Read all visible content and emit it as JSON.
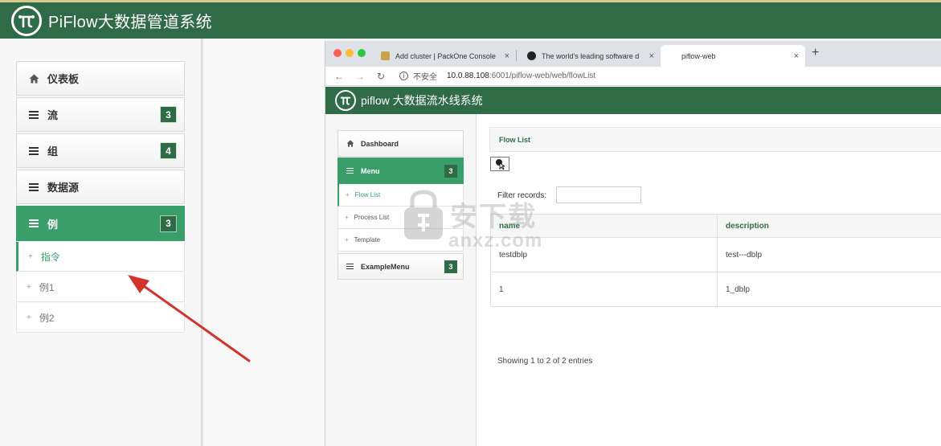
{
  "app": {
    "title": "PiFlow大数据管道系统"
  },
  "sidebar": {
    "items": [
      {
        "label": "仪表板",
        "icon": "home-icon",
        "badge": ""
      },
      {
        "label": "流",
        "icon": "menu-icon",
        "badge": "3"
      },
      {
        "label": "组",
        "icon": "menu-icon",
        "badge": "4"
      },
      {
        "label": "数据源",
        "icon": "menu-icon",
        "badge": ""
      },
      {
        "label": "例",
        "icon": "menu-icon",
        "badge": "3",
        "active": true
      }
    ],
    "sub_items": [
      {
        "label": "指令",
        "current": true
      },
      {
        "label": "例1"
      },
      {
        "label": "例2"
      }
    ]
  },
  "browser": {
    "tabs": [
      {
        "title": "Add cluster | PackOne Console"
      },
      {
        "title": "The world's leading software d"
      },
      {
        "title": "piflow-web",
        "active": true
      }
    ],
    "address": {
      "security": "不安全",
      "host": "10.0.88.108",
      "path": ":6001/piflow-web/web/flowList"
    }
  },
  "inner": {
    "title": "piflow 大数据流水线系统",
    "menu": [
      {
        "label": "Dashboard",
        "badge": ""
      },
      {
        "label": "Menu",
        "badge": "3",
        "active": true
      },
      {
        "label": "ExampleMenu",
        "badge": "3"
      }
    ],
    "sub_items": [
      {
        "label": "Flow List",
        "current": true
      },
      {
        "label": "Process List"
      },
      {
        "label": "Template"
      }
    ],
    "panel_title": "Flow List",
    "filter_label": "Filter records:",
    "table": {
      "headers": [
        "name",
        "description"
      ],
      "rows": [
        [
          "testdblp",
          "test---dblp"
        ],
        [
          "1",
          "1_dblp"
        ]
      ]
    },
    "showing": "Showing 1 to 2 of 2 entries"
  },
  "watermark": {
    "text": "安下载",
    "sub": "anxz.com"
  },
  "colors": {
    "brand_green": "#2f6b47",
    "active_green": "#3a9e6a",
    "arrow_red": "#d0342c"
  }
}
